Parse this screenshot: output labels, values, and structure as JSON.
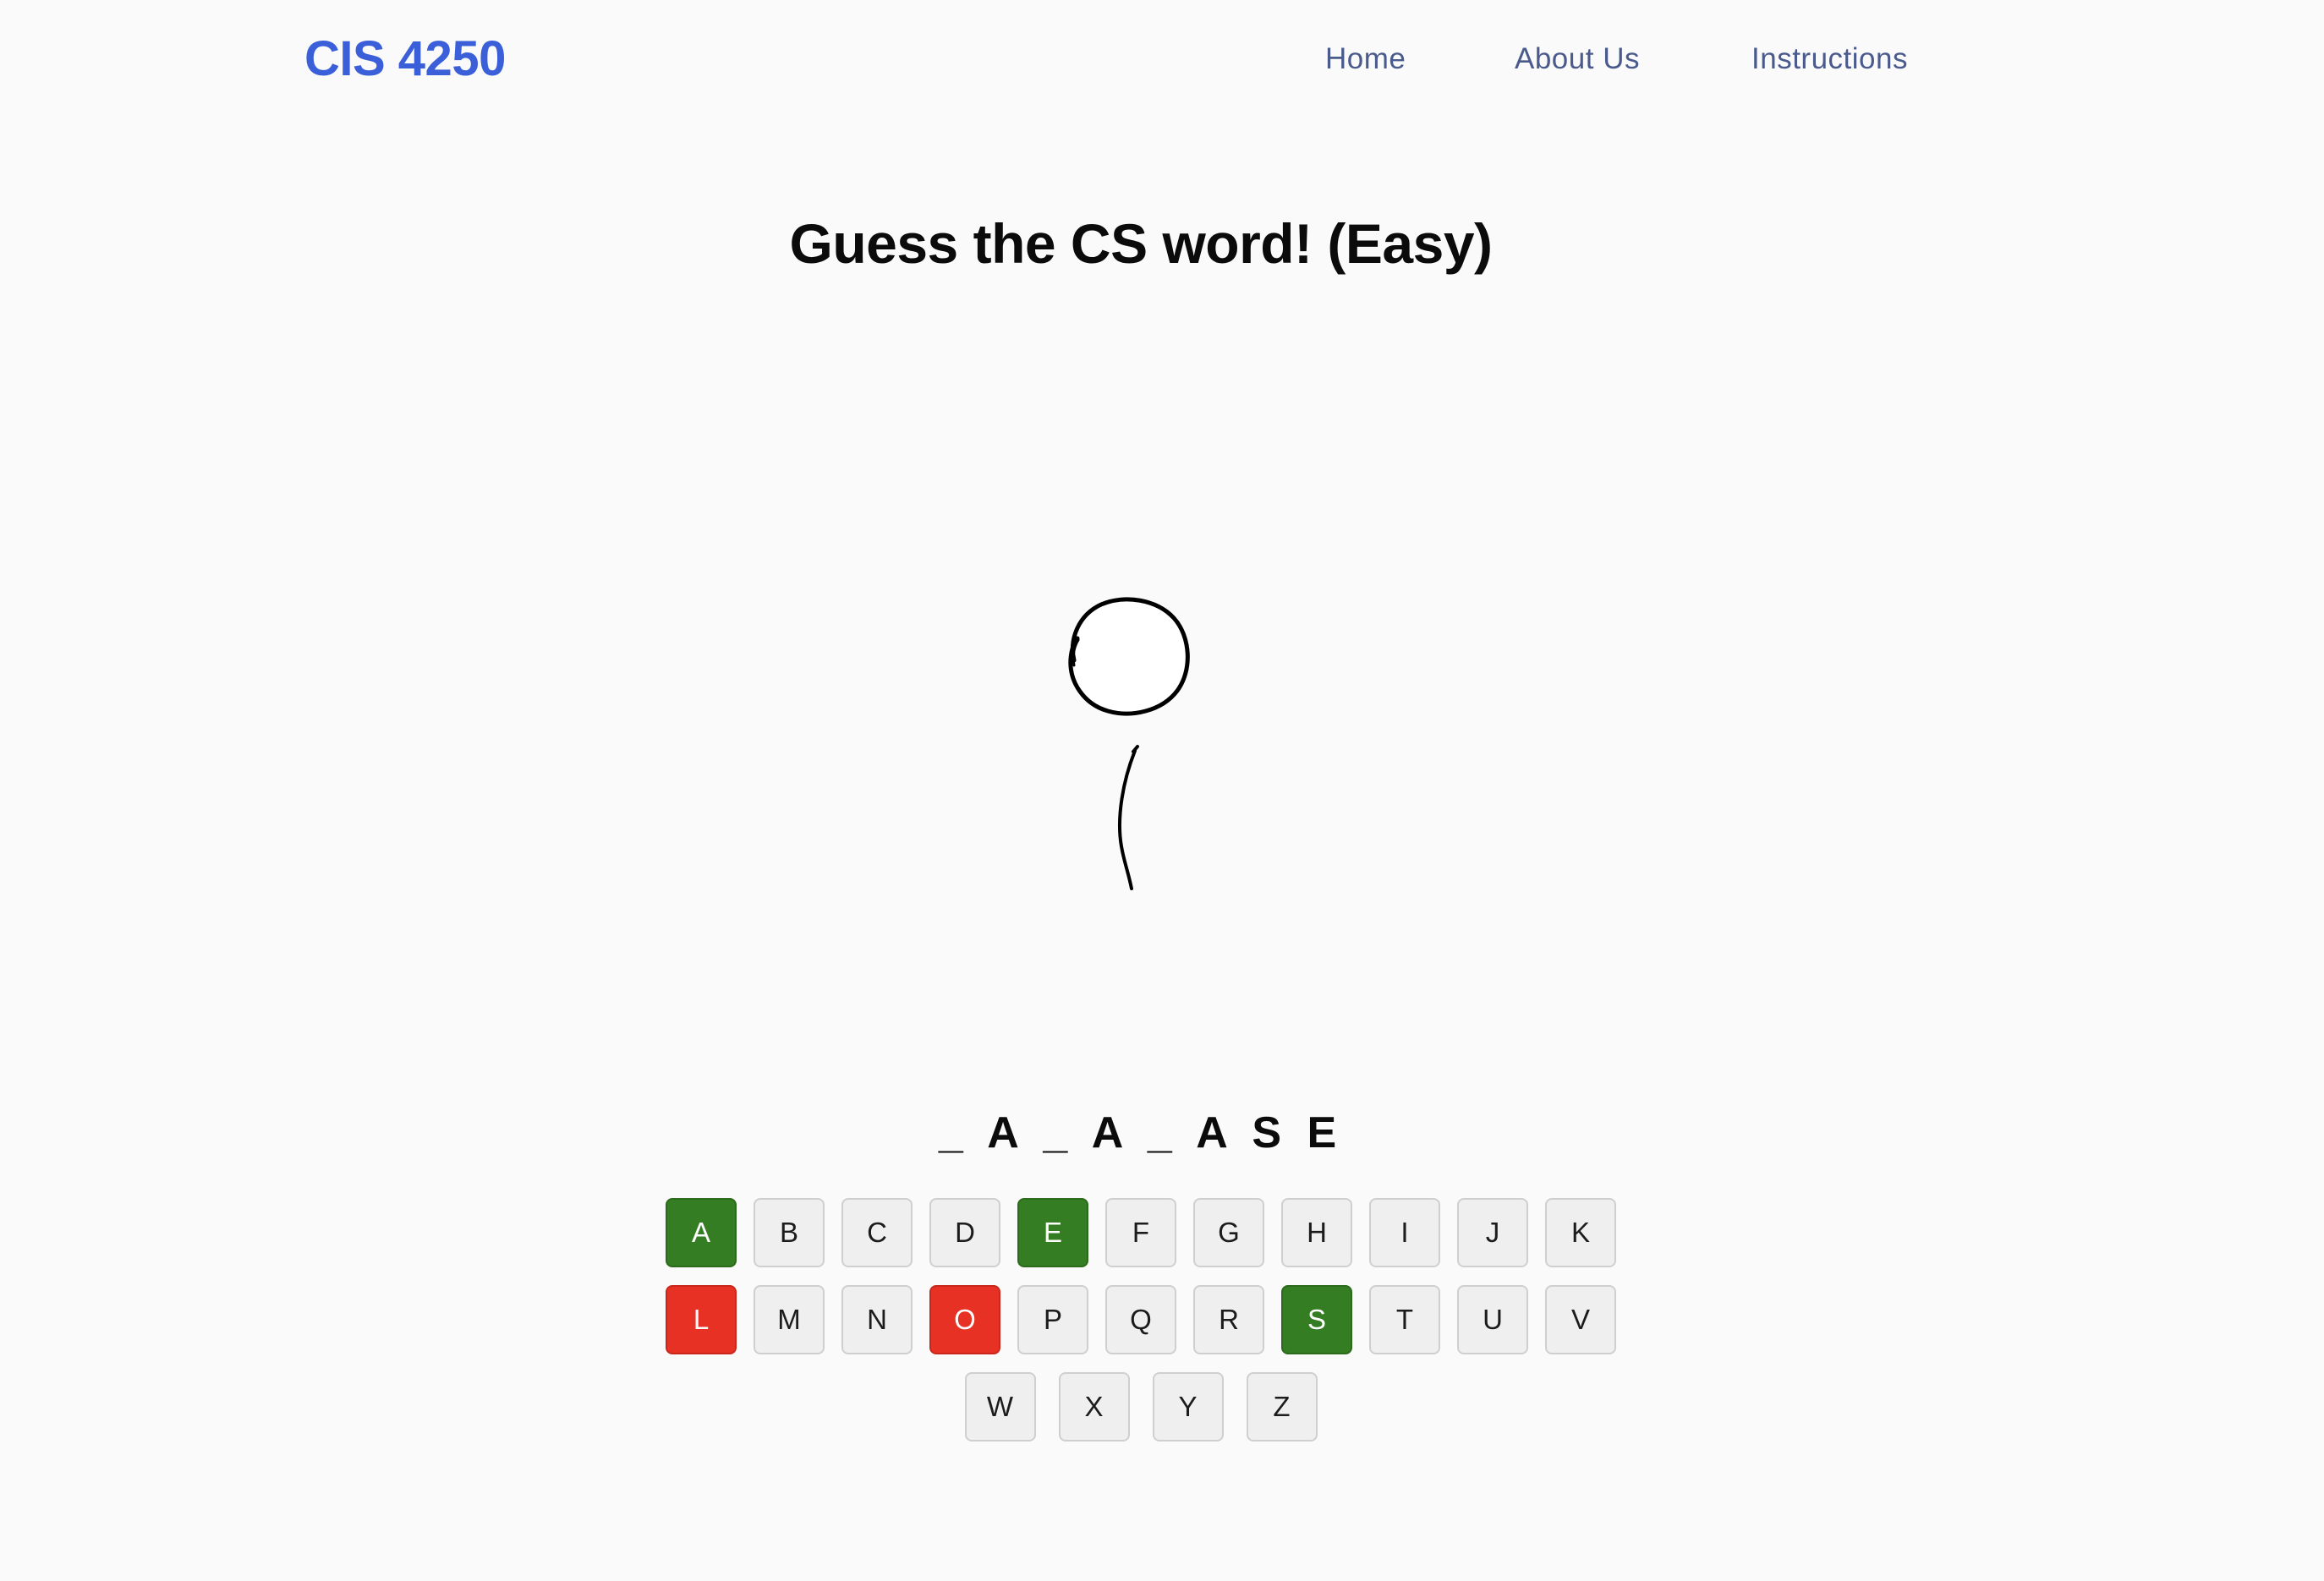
{
  "navbar": {
    "brand": "CIS 4250",
    "links": [
      "Home",
      "About Us",
      "Instructions"
    ]
  },
  "game": {
    "title": "Guess the CS word! (Easy)",
    "word_display": "_ A _ A _ A S E",
    "keyboard": {
      "row1": [
        {
          "letter": "A",
          "state": "correct"
        },
        {
          "letter": "B",
          "state": "unused"
        },
        {
          "letter": "C",
          "state": "unused"
        },
        {
          "letter": "D",
          "state": "unused"
        },
        {
          "letter": "E",
          "state": "correct"
        },
        {
          "letter": "F",
          "state": "unused"
        },
        {
          "letter": "G",
          "state": "unused"
        },
        {
          "letter": "H",
          "state": "unused"
        },
        {
          "letter": "I",
          "state": "unused"
        },
        {
          "letter": "J",
          "state": "unused"
        },
        {
          "letter": "K",
          "state": "unused"
        }
      ],
      "row2": [
        {
          "letter": "L",
          "state": "wrong"
        },
        {
          "letter": "M",
          "state": "unused"
        },
        {
          "letter": "N",
          "state": "unused"
        },
        {
          "letter": "O",
          "state": "wrong"
        },
        {
          "letter": "P",
          "state": "unused"
        },
        {
          "letter": "Q",
          "state": "unused"
        },
        {
          "letter": "R",
          "state": "unused"
        },
        {
          "letter": "S",
          "state": "correct"
        },
        {
          "letter": "T",
          "state": "unused"
        },
        {
          "letter": "U",
          "state": "unused"
        },
        {
          "letter": "V",
          "state": "unused"
        }
      ],
      "row3": [
        {
          "letter": "W",
          "state": "unused"
        },
        {
          "letter": "X",
          "state": "unused"
        },
        {
          "letter": "Y",
          "state": "unused"
        },
        {
          "letter": "Z",
          "state": "unused"
        }
      ]
    }
  },
  "colors": {
    "brand": "#3b5fd9",
    "nav_link": "#4a5a8c",
    "correct": "#357d22",
    "wrong": "#e73124",
    "key_default": "#efefef",
    "background": "#f9faf9"
  },
  "icons": {
    "balloon": "balloon-icon"
  }
}
